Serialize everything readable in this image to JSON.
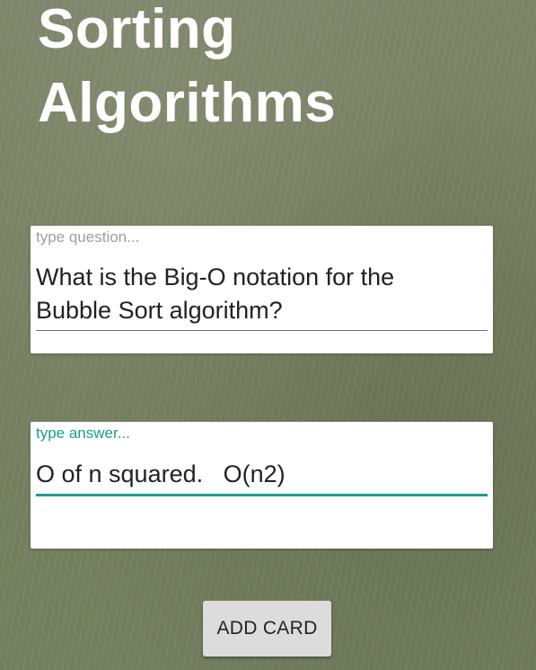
{
  "header": {
    "title": "Sorting\nAlgorithms"
  },
  "question_field": {
    "placeholder": "type question...",
    "value": "What is the Big-O notation for the\nBubble Sort algorithm?"
  },
  "answer_field": {
    "placeholder": "type answer...",
    "value": "O of n squared.   O(n2)"
  },
  "actions": {
    "add_card_label": "ADD CARD"
  },
  "colors": {
    "accent": "#1a9e8c",
    "background": "#7a8468",
    "card": "#ffffff",
    "button": "#dcdcdc"
  }
}
